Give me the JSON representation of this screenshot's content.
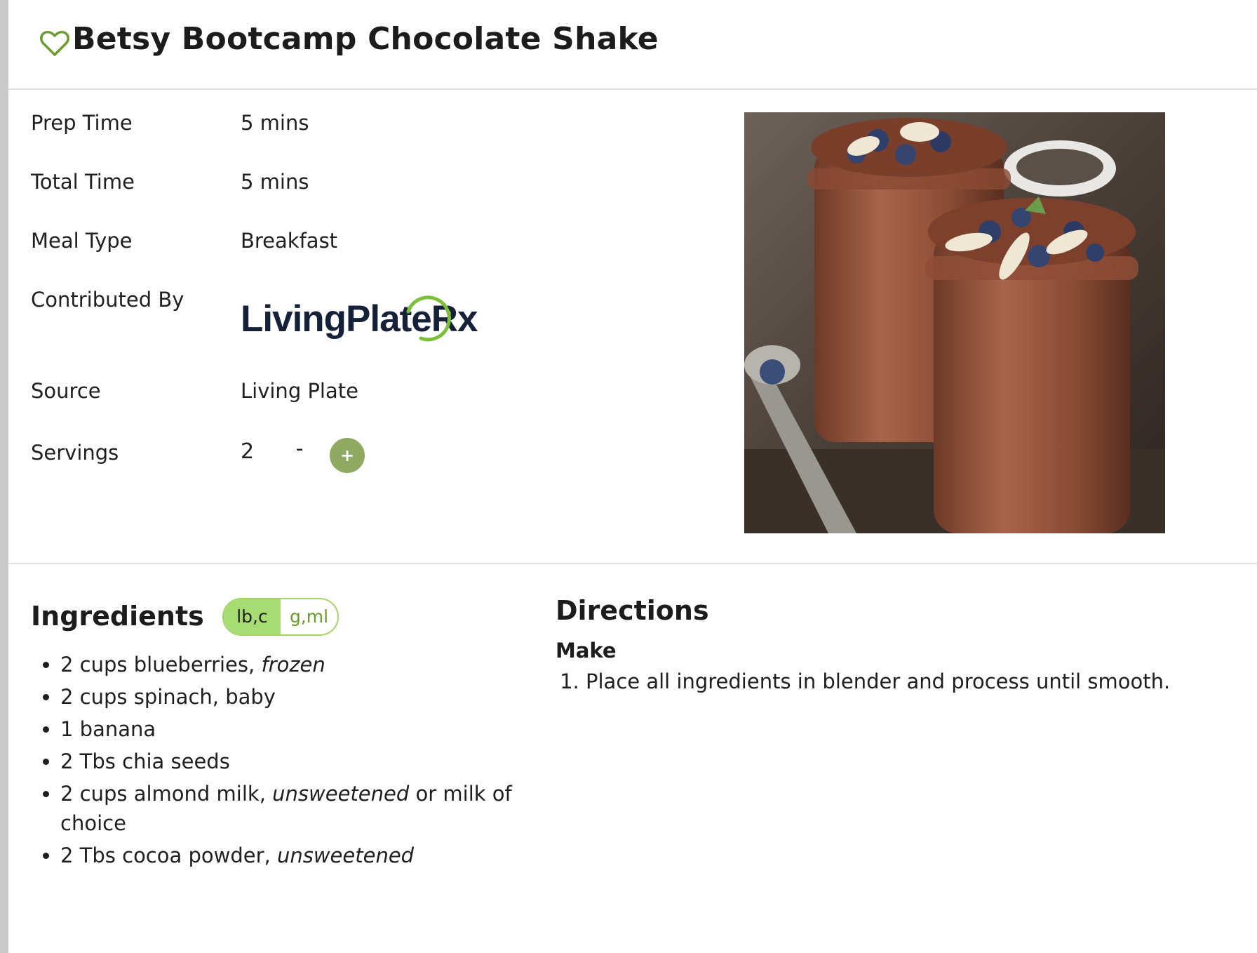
{
  "recipe": {
    "title": "Betsy Bootcamp Chocolate Shake",
    "favorite_icon": "heart-outline-icon",
    "accent_color": "#6b9a2e"
  },
  "details": {
    "prep_time": {
      "label": "Prep Time",
      "value": "5 mins"
    },
    "total_time": {
      "label": "Total Time",
      "value": "5 mins"
    },
    "meal_type": {
      "label": "Meal Type",
      "value": "Breakfast"
    },
    "contributed_by": {
      "label": "Contributed By",
      "logo_text": "LivingPlateRx"
    },
    "source": {
      "label": "Source",
      "value": "Living Plate"
    },
    "servings": {
      "label": "Servings",
      "value": "2",
      "decrement_label": "-",
      "increment_label": "+"
    }
  },
  "ingredients": {
    "heading": "Ingredients",
    "unit_options": [
      {
        "label": "lb,c",
        "active": true
      },
      {
        "label": "g,ml",
        "active": false
      }
    ],
    "items": [
      {
        "text": "2 cups blueberries, ",
        "note": "frozen",
        "suffix": ""
      },
      {
        "text": "2 cups spinach, baby",
        "note": "",
        "suffix": ""
      },
      {
        "text": "1 banana",
        "note": "",
        "suffix": ""
      },
      {
        "text": "2 Tbs chia seeds",
        "note": "",
        "suffix": ""
      },
      {
        "text": "2 cups almond milk, ",
        "note": "unsweetened",
        "suffix": " or milk of choice"
      },
      {
        "text": "2 Tbs cocoa powder, ",
        "note": "unsweetened",
        "suffix": ""
      }
    ]
  },
  "directions": {
    "heading": "Directions",
    "subheading": "Make",
    "steps": [
      "Place all ingredients in blender and process until smooth."
    ]
  }
}
